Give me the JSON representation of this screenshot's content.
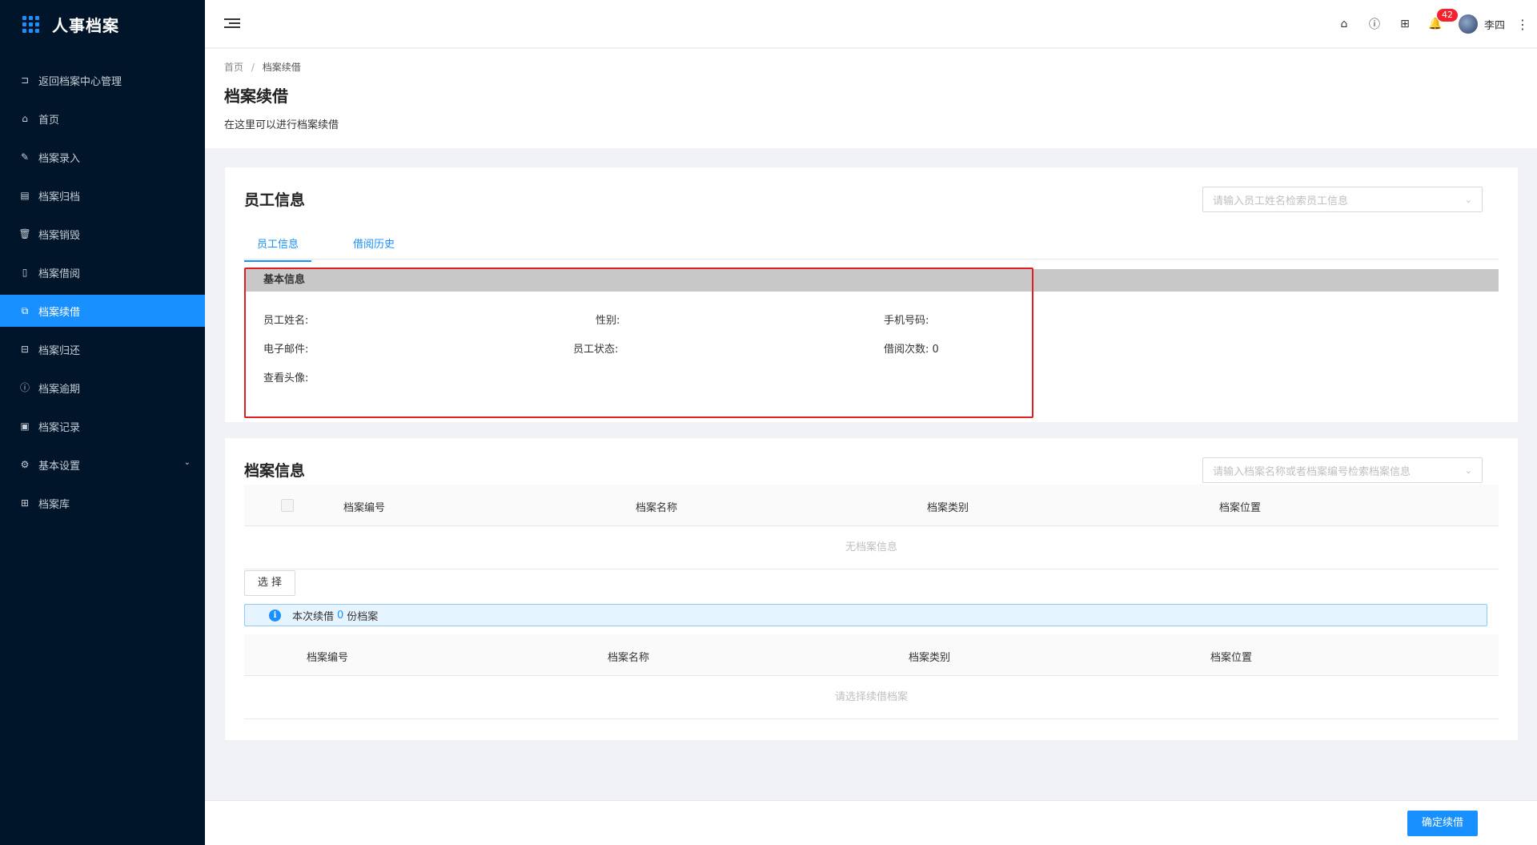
{
  "app": {
    "title": "人事档案"
  },
  "sidebar": {
    "items": [
      {
        "label": "返回档案中心管理",
        "icon": "return-icon"
      },
      {
        "label": "首页",
        "icon": "home-icon"
      },
      {
        "label": "档案录入",
        "icon": "edit-icon"
      },
      {
        "label": "档案归档",
        "icon": "archive-icon"
      },
      {
        "label": "档案销毁",
        "icon": "trash-icon"
      },
      {
        "label": "档案借阅",
        "icon": "book-icon"
      },
      {
        "label": "档案续借",
        "icon": "renew-icon",
        "active": true
      },
      {
        "label": "档案归还",
        "icon": "return-box-icon"
      },
      {
        "label": "档案逾期",
        "icon": "alert-circle-icon"
      },
      {
        "label": "档案记录",
        "icon": "record-icon"
      },
      {
        "label": "基本设置",
        "icon": "gear-icon"
      },
      {
        "label": "档案库",
        "icon": "grid-icon"
      }
    ]
  },
  "header": {
    "notification_count": "42",
    "user_name": "李四"
  },
  "breadcrumb": {
    "home": "首页",
    "separator": "/",
    "current": "档案续借"
  },
  "page": {
    "title": "档案续借",
    "description": "在这里可以进行档案续借"
  },
  "employee_card": {
    "title": "员工信息",
    "search_placeholder": "请输入员工姓名检索员工信息",
    "tabs": [
      "员工信息",
      "借阅历史"
    ],
    "basic_info_title": "基本信息",
    "fields": {
      "name_label": "员工姓名:",
      "gender_label": "性别:",
      "phone_label": "手机号码:",
      "email_label": "电子邮件:",
      "status_label": "员工状态:",
      "borrow_count_label": "借阅次数:",
      "borrow_count_value": "0",
      "avatar_label": "查看头像:"
    }
  },
  "archive_card": {
    "title": "档案信息",
    "search_placeholder": "请输入档案名称或者档案编号检索档案信息",
    "columns": [
      "档案编号",
      "档案名称",
      "档案类别",
      "档案位置"
    ],
    "empty_text": "无档案信息",
    "select_button": "选 择",
    "info_prefix": "本次续借",
    "info_count": "0",
    "info_suffix": "份档案",
    "selected_columns": [
      "档案编号",
      "档案名称",
      "档案类别",
      "档案位置"
    ],
    "selected_empty_text": "请选择续借档案"
  },
  "footer": {
    "confirm_button": "确定续借"
  },
  "colors": {
    "primary": "#1890ff",
    "sidebar_bg": "#001529",
    "highlight_border": "#e02020",
    "badge": "#f5222d"
  }
}
